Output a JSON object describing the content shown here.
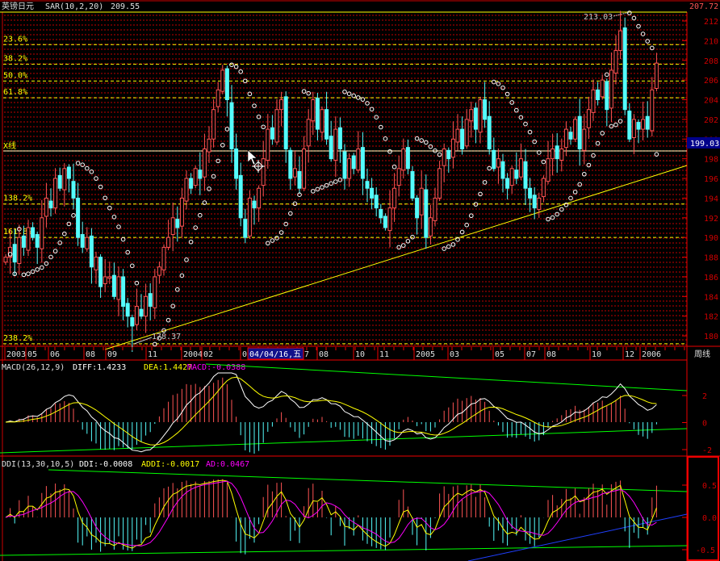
{
  "header": {
    "instrument": "英镑日元",
    "indicator": "SAR(10,2,20)",
    "indicator_value": "209.55",
    "last_price": "207.72"
  },
  "fib_levels": [
    "23.6%",
    "38.2%",
    "50.0%",
    "61.8%",
    "138.2%",
    "161.8%",
    "238.2%"
  ],
  "fib_prices": [
    209.6,
    207.6,
    205.9,
    204.2,
    193.4,
    190.0,
    179.2
  ],
  "x_line": {
    "label": "X线",
    "price": "199.03"
  },
  "annotations": {
    "high": "213.03",
    "low": "178.37"
  },
  "price_axis": [
    "212",
    "210",
    "208",
    "206",
    "204",
    "202",
    "200",
    "198",
    "196",
    "194",
    "192",
    "190",
    "188",
    "186",
    "184",
    "182",
    "180"
  ],
  "date_axis": [
    "2003",
    "05",
    "06",
    "08",
    "09",
    "11",
    "2004",
    "02",
    "0",
    "7",
    "08",
    "10",
    "11",
    "2005",
    "03",
    "05",
    "07",
    "08",
    "10",
    "12",
    "2006"
  ],
  "cursor_date": "04/04/16,五",
  "period_label": "周线",
  "macd": {
    "title": "MACD(26,12,9)",
    "diff": "DIFF:1.4233",
    "dea": "DEA:1.4427",
    "macd": "MACD:-0.0388",
    "axis": [
      "2",
      "0",
      "-2"
    ]
  },
  "ddi": {
    "title": "DDI(13,30,10,5)",
    "ddi": "DDI:-0.0008",
    "addi": "ADDI:-0.0017",
    "ad": "AD:0.0467",
    "axis": [
      "0.5",
      "0.0",
      "-0.5"
    ]
  },
  "colors": {
    "up": "#ff5454",
    "down": "#54fcfc",
    "fib": "#ffff00",
    "grid": "#8a0000",
    "sar": "#ffffff",
    "diff": "#ffffff",
    "dea": "#ffff00",
    "ad": "#ff00ff",
    "trend": "#00ff00",
    "axis": "#ff0000"
  },
  "chart_data": {
    "type": "candlestick",
    "title": "英镑日元 weekly",
    "ylim": [
      179,
      213.5
    ],
    "closes": [
      188,
      189,
      187.5,
      190,
      189,
      191,
      190,
      189,
      192,
      194,
      193,
      196,
      195,
      197,
      196,
      194,
      190,
      189,
      190,
      187,
      188,
      185,
      186,
      186,
      184,
      186,
      183,
      182,
      181,
      183,
      182,
      184,
      183,
      186,
      187,
      189,
      190,
      192,
      191,
      194,
      196,
      195,
      197,
      196,
      199,
      200,
      203,
      205,
      207,
      204,
      199,
      196,
      192,
      190,
      194,
      193,
      195,
      198,
      201,
      200,
      203,
      204,
      199,
      196,
      197,
      195,
      199,
      202,
      204,
      201,
      203,
      200,
      198,
      201,
      199,
      196,
      198,
      197,
      199,
      196,
      195,
      194,
      193,
      192,
      191,
      193,
      195,
      197,
      199,
      197,
      194,
      192,
      195,
      190,
      192,
      194,
      197,
      199,
      198,
      200,
      201,
      199,
      202,
      203,
      201,
      204,
      202,
      199,
      197,
      198,
      196,
      195,
      197,
      196,
      198,
      195,
      194,
      193,
      194,
      196,
      198,
      199,
      198,
      199,
      201,
      200,
      202,
      199,
      201,
      203,
      205,
      204,
      206,
      203,
      207,
      209,
      211,
      203,
      200,
      202,
      201,
      202,
      201,
      205,
      207.72
    ],
    "high_point": 213.03,
    "low_point": 178.37
  }
}
